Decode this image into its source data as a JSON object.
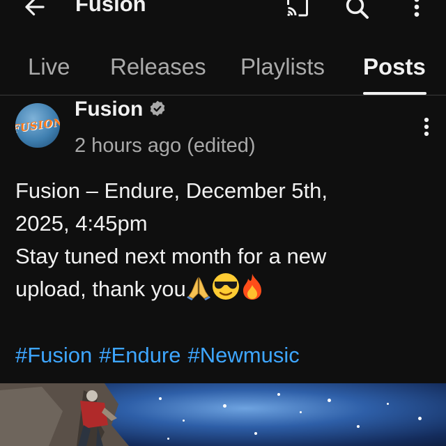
{
  "header": {
    "title": "Fusion",
    "icons": {
      "back": "arrow-left-icon",
      "cast": "cast-icon",
      "search": "search-icon",
      "more": "more-vert-icon"
    }
  },
  "tabs": [
    {
      "label": "Live",
      "active": false
    },
    {
      "label": "Releases",
      "active": false
    },
    {
      "label": "Playlists",
      "active": false
    },
    {
      "label": "Posts",
      "active": true
    }
  ],
  "post": {
    "channel": "Fusion",
    "avatar_text": "FUSION",
    "time": "2 hours ago (edited)",
    "body_lines": [
      "Fusion – Endure, December 5th,",
      "2025, 4:45pm",
      "Stay tuned next month for a new",
      "upload, thank you"
    ],
    "emojis": [
      "🙏",
      "😎",
      "🔥"
    ],
    "hashtags": [
      "#Fusion",
      "#Endure",
      "#Newmusic"
    ]
  },
  "colors": {
    "background": "#0f0f0f",
    "text": "#f1f1f1",
    "secondary_text": "#aaaaaa",
    "link": "#3ea6ff"
  }
}
